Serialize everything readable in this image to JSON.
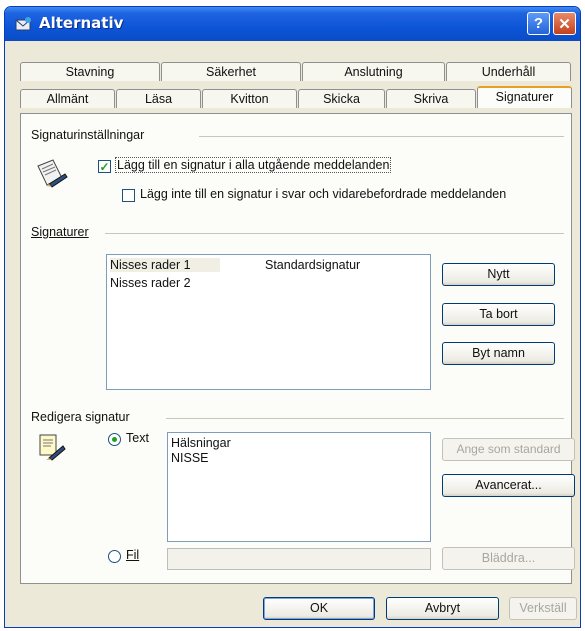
{
  "window": {
    "title": "Alternativ",
    "help_label": "?",
    "close_label": "✕"
  },
  "tabs": {
    "back_row": [
      "Stavning",
      "Säkerhet",
      "Anslutning",
      "Underhåll"
    ],
    "front_row": [
      "Allmänt",
      "Läsa",
      "Kvitton",
      "Skicka",
      "Skriva",
      "Signaturer"
    ],
    "active": "Signaturer"
  },
  "settings_group": {
    "label": "Signaturinställningar",
    "add_signature_checkbox": {
      "label": "Lägg till en signatur i alla utgående meddelanden",
      "checked": true,
      "mark": "✓"
    },
    "no_reply_checkbox": {
      "label": "Lägg inte till en signatur i svar och vidarebefordrade meddelanden",
      "checked": false
    }
  },
  "signatures_group": {
    "label": "Signaturer",
    "items": [
      {
        "name": "Nisses rader 1",
        "tag": "Standardsignatur"
      },
      {
        "name": "Nisses rader 2",
        "tag": ""
      }
    ],
    "buttons": {
      "new": "Nytt",
      "remove": "Ta bort",
      "rename": "Byt namn"
    }
  },
  "edit_group": {
    "label": "Redigera signatur",
    "text_radio": {
      "label": "Text",
      "selected": true
    },
    "text_content": [
      "Hälsningar",
      "NISSE"
    ],
    "file_radio": {
      "label": "Fil",
      "selected": false
    },
    "file_path": "",
    "buttons": {
      "set_default": "Ange som standard",
      "advanced": "Avancerat...",
      "browse": "Bläddra..."
    }
  },
  "footer": {
    "ok": "OK",
    "cancel": "Avbryt",
    "apply": "Verkställ"
  },
  "colors": {
    "titlebar": "#0d55d8",
    "dialog_bg": "#ece9d8",
    "active_tab_accent": "#e8a024",
    "check_green": "#21a121"
  }
}
